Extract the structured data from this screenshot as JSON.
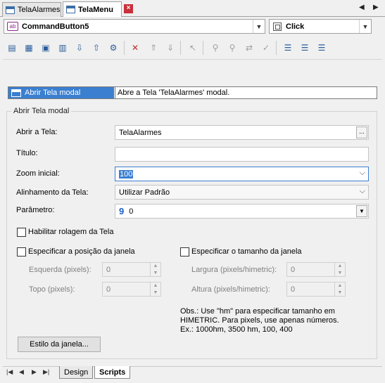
{
  "tabs": [
    {
      "label": "TelaAlarmes",
      "active": false
    },
    {
      "label": "TelaMenu",
      "active": true
    }
  ],
  "object_combo": {
    "icon_text": "ab",
    "value": "CommandButton5"
  },
  "event_combo": {
    "value": "Click"
  },
  "toolbar_icons": [
    "new-script-icon",
    "new-action-icon",
    "new-picture-icon",
    "new-form-icon",
    "import-icon",
    "export-icon",
    "settings-icon",
    "delete-icon",
    "move-up-icon",
    "move-down-icon",
    "pick-icon",
    "find-icon",
    "find-next-icon",
    "replace-icon",
    "spell-icon",
    "list-icon",
    "list-check-icon",
    "list-all-icon"
  ],
  "action": {
    "name": "Abrir Tela modal",
    "description": "Abre a Tela 'TelaAlarmes' modal."
  },
  "group_title": "Abrir Tela modal",
  "form": {
    "abrir_tela_label": "Abrir a Tela:",
    "abrir_tela_value": "TelaAlarmes",
    "browse_label": "...",
    "titulo_label": "Título:",
    "titulo_value": "",
    "zoom_label": "Zoom inicial:",
    "zoom_value": "100",
    "alinhamento_label": "Alinhamento da Tela:",
    "alinhamento_value": "Utilizar Padrão",
    "parametro_label": "Parâmetro:",
    "parametro_icon": "9",
    "parametro_value": "0",
    "rolagem_label": "Habilitar rolagem da Tela",
    "rolagem_checked": false,
    "posicao_label": "Especificar a posição da janela",
    "posicao_checked": false,
    "tamanho_label": "Especificar o tamanho da janela",
    "tamanho_checked": false,
    "esquerda_label": "Esquerda (pixels):",
    "esquerda_value": "0",
    "topo_label": "Topo (pixels):",
    "topo_value": "0",
    "largura_label": "Largura (pixels/himetric):",
    "largura_value": "0",
    "altura_label": "Altura (pixels/himetric):",
    "altura_value": "0",
    "obs_line1": "Obs.: Use \"hm\" para especificar tamanho em",
    "obs_line2": "HIMETRIC. Para pixels, use apenas números.",
    "obs_line3": "Ex.: 1000hm, 3500 hm, 100, 400",
    "estilo_button": "Estilo da janela..."
  },
  "bottom_tabs": [
    {
      "label": "Design",
      "active": false
    },
    {
      "label": "Scripts",
      "active": true
    }
  ],
  "colors": {
    "selection": "#3a7fd0",
    "close_tab": "#c8303a",
    "delete_icon": "#c0282d"
  }
}
